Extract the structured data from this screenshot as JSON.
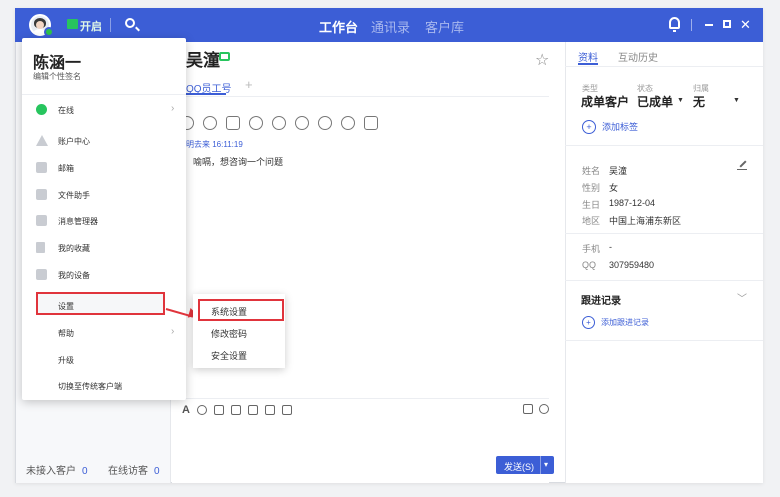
{
  "topbar": {
    "open_label": "开启",
    "nav": [
      "工作台",
      "通讯录",
      "客户库"
    ],
    "close_glyph": "✕"
  },
  "profile": {
    "name": "陈涵一",
    "signature": "编辑个性签名"
  },
  "menu_items": [
    {
      "label": "在线",
      "icon": "online-status-icon",
      "arrow": "›"
    },
    {
      "label": "账户中心",
      "icon": "account-icon"
    },
    {
      "label": "邮箱",
      "icon": "mail-icon"
    },
    {
      "label": "文件助手",
      "icon": "folder-icon"
    },
    {
      "label": "消息管理器",
      "icon": "message-icon"
    },
    {
      "label": "我的收藏",
      "icon": "bookmark-icon"
    },
    {
      "label": "我的设备",
      "icon": "device-icon"
    },
    {
      "label": "设置",
      "icon": ""
    },
    {
      "label": "帮助",
      "icon": "",
      "arrow": "›"
    },
    {
      "label": "升级",
      "icon": ""
    },
    {
      "label": "切换至传统客户端",
      "icon": ""
    }
  ],
  "settings_submenu": [
    "系统设置",
    "修改密码",
    "安全设置"
  ],
  "left_footer": {
    "unassigned_label": "未接入客户",
    "unassigned_count": "0",
    "visitors_label": "在线访客",
    "visitors_count": "0"
  },
  "chat": {
    "contact_name": "吴潼",
    "tab_label": "QQ员工号",
    "tab_add": "+",
    "message_meta": "明去来 16:11:19",
    "message_text": "喻嗝，想咨询一个问题",
    "send_label": "发送(S)",
    "send_arrow": "▾"
  },
  "profile_panel": {
    "tabs": [
      "资料",
      "互动历史"
    ],
    "type_key": "类型",
    "type_val": "成单客户",
    "status_key": "状态",
    "status_val": "已成单",
    "owner_key": "归属",
    "owner_val": "无",
    "add_tag": "添加标签",
    "fields": [
      {
        "k": "姓名",
        "v": "吴潼"
      },
      {
        "k": "性别",
        "v": "女"
      },
      {
        "k": "生日",
        "v": "1987-12-04"
      },
      {
        "k": "地区",
        "v": "中国上海浦东新区"
      },
      {
        "k": "手机",
        "v": "-"
      },
      {
        "k": "QQ",
        "v": "307959480"
      }
    ],
    "follow_title": "跟进记录",
    "add_follow": "添加跟进记录"
  },
  "colors": {
    "accent": "#3c5ed6",
    "online": "#27c55e",
    "highlight": "#e0343c"
  }
}
